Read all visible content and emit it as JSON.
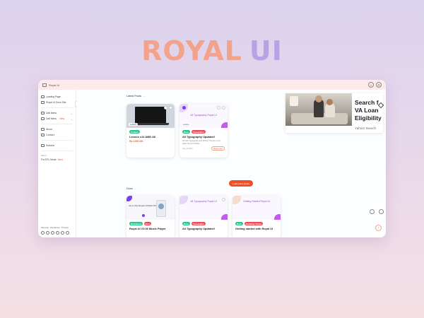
{
  "brand": {
    "word1": "ROYAL",
    "word2": "UI"
  },
  "window": {
    "topbar": {
      "title": "Royal UI"
    },
    "sidebar": {
      "items": [
        {
          "label": "Landing Page",
          "icon": "page-icon"
        },
        {
          "label": "Royal UI Docs Site",
          "icon": "docs-icon"
        },
        {
          "label": "Dall Menu",
          "icon": "menu-icon",
          "chevron": "⌄"
        },
        {
          "label": "Dall Menu",
          "icon": "menu-icon",
          "new": "New",
          "chevron": "⌄"
        },
        {
          "label": "About",
          "icon": "info-icon"
        },
        {
          "label": "Contact",
          "icon": "contact-icon"
        },
        {
          "label": "Subiche",
          "icon": "user-icon"
        }
      ],
      "mode_label": "Menu",
      "rtl_label": "For RTL Mode",
      "rtl_state": "Next",
      "footer_links": [
        "Sitemap",
        "Disclaimer",
        "Privacy"
      ]
    },
    "latest": {
      "title": "Latest Posts",
      "cards": [
        {
          "tags": [
            {
              "label": "Product",
              "color": "green"
            }
          ],
          "title": "Lenovo v14 AMD A6",
          "price": "Rp.4.850.000",
          "badge": "Lenovo"
        },
        {
          "thumb_title": "All Typography Royal UI",
          "tags": [
            {
              "label": "Docs",
              "color": "green"
            },
            {
              "label": "Typography",
              "color": "red"
            }
          ],
          "title": "All Typography Updated!",
          "excerpt": "All New Typography and Writing Themes in the latest Royal UI Editio...",
          "date": "Aug 11 2023",
          "read_more": "Read more",
          "badge": "Lenovo"
        }
      ],
      "load_more": "Load more posts"
    },
    "docs": {
      "title": "Docs",
      "cards": [
        {
          "thumb_title": "ow to Use Royal UI Music Player",
          "tags": [
            {
              "label": "Dashboard",
              "color": "green"
            },
            {
              "label": "Docs",
              "color": "red"
            }
          ],
          "title": "Royal UI V3.06 Music Player"
        },
        {
          "thumb_title": "All Typography Royal UI",
          "tags": [
            {
              "label": "Docs",
              "color": "green"
            },
            {
              "label": "Typography",
              "color": "red"
            }
          ],
          "title": "All Typography Updated!"
        },
        {
          "thumb_title": "Getting Started Royal UI",
          "tags": [
            {
              "label": "Docs",
              "color": "green"
            },
            {
              "label": "Installing Theme",
              "color": "red"
            }
          ],
          "title": "Getting started with Royal UI"
        }
      ]
    }
  },
  "ad": {
    "headline_1": "Search f",
    "headline_2": "VA Loan",
    "headline_3": "Eligibility",
    "source": "Yahoo! Search"
  },
  "colors": {
    "accent": "#f04e23",
    "tag_green": "#31c48d",
    "tag_red": "#ea4d5b",
    "brand_peach": "#f3a38c",
    "brand_lilac": "#b9a1e6"
  }
}
